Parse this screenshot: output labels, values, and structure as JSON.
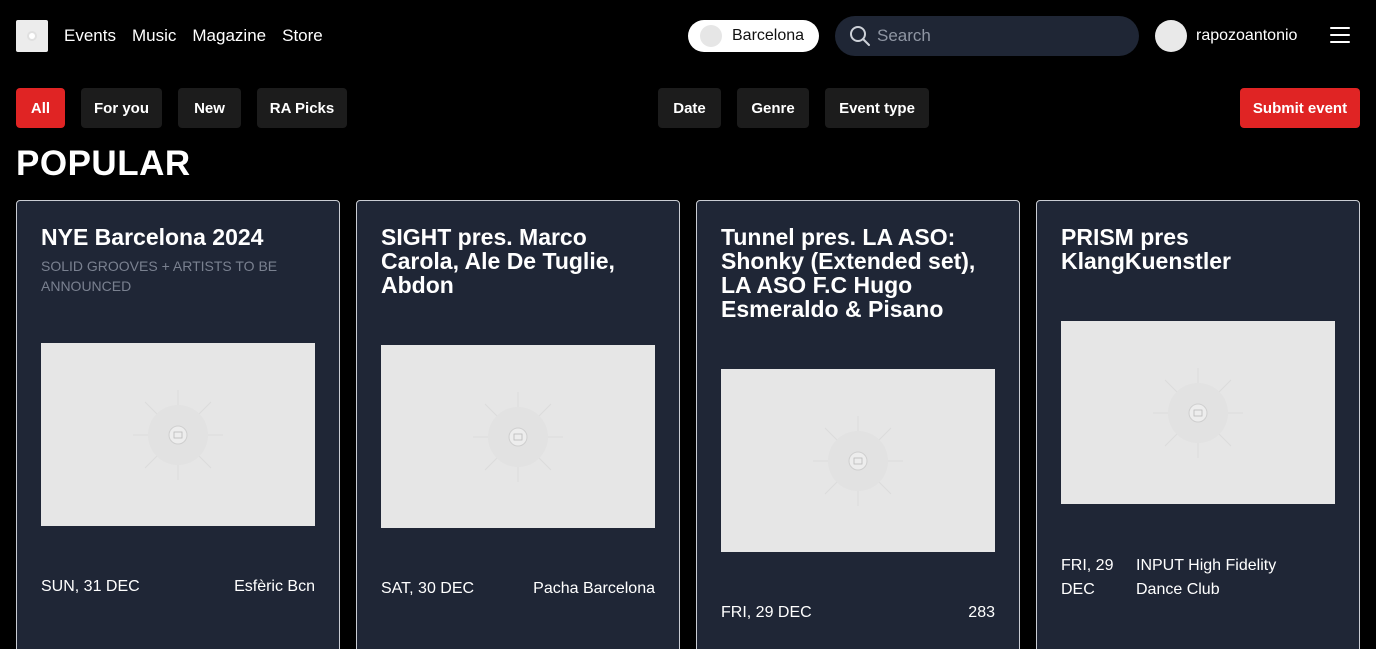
{
  "nav": {
    "links": [
      "Events",
      "Music",
      "Magazine",
      "Store"
    ],
    "city": "Barcelona",
    "search_placeholder": "Search",
    "username": "rapozoantonio"
  },
  "filters": {
    "tabs": [
      "All",
      "For you",
      "New",
      "RA Picks"
    ],
    "dropdowns": [
      "Date",
      "Genre",
      "Event type"
    ],
    "submit": "Submit event"
  },
  "section_title": "POPULAR",
  "events": [
    {
      "title": "NYE Barcelona 2024",
      "subtitle": "SOLID GROOVES + ARTISTS TO BE ANNOUNCED",
      "date": "SUN, 31 DEC",
      "venue": "Esfèric Bcn"
    },
    {
      "title": "SIGHT pres. Marco Carola, Ale De Tuglie, Abdon",
      "subtitle": "",
      "date": "SAT, 30 DEC",
      "venue": "Pacha Barcelona"
    },
    {
      "title": "Tunnel pres. LA ASO: Shonky (Extended set), LA ASO F.C Hugo Esmeraldo & Pisano",
      "subtitle": "",
      "date": "FRI, 29 DEC",
      "venue": "283"
    },
    {
      "title": "PRISM pres KlangKuenstler",
      "subtitle": "",
      "date": "FRI, 29 DEC",
      "venue": "INPUT High Fidelity Dance Club"
    }
  ],
  "colors": {
    "accent": "#e02424",
    "card_bg": "#1f2636",
    "filter_bg": "#1c1c1c"
  }
}
